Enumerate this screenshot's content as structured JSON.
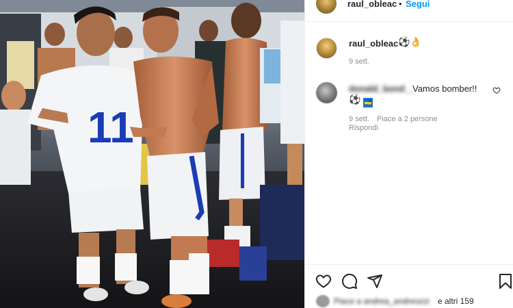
{
  "header": {
    "username": "raul_obleac",
    "separator": "•",
    "follow_label": "Segui"
  },
  "caption": {
    "username": "raul_obleac",
    "emoji": "⚽👌",
    "time": "9 sett."
  },
  "comment": {
    "username": "donald_bond__",
    "text": "Vamos bomber!!",
    "emoji": "⚽",
    "flag_emoji": "🇺🇦",
    "time": "9 sett.",
    "likes": "Piace a 2 persone",
    "reply_label": "Rispondi"
  },
  "likes_summary": {
    "blurred_text": "Piace a andrea_andreozzi",
    "others_text": "e altri 159"
  },
  "photo": {
    "jersey_number": "11"
  },
  "icons": {
    "like": "heart-icon",
    "comment": "comment-icon",
    "share": "send-icon",
    "save": "bookmark-icon"
  },
  "colors": {
    "follow": "#0095f6",
    "secondary_text": "#8e8e8e",
    "jersey_number": "#1a3cb5"
  }
}
